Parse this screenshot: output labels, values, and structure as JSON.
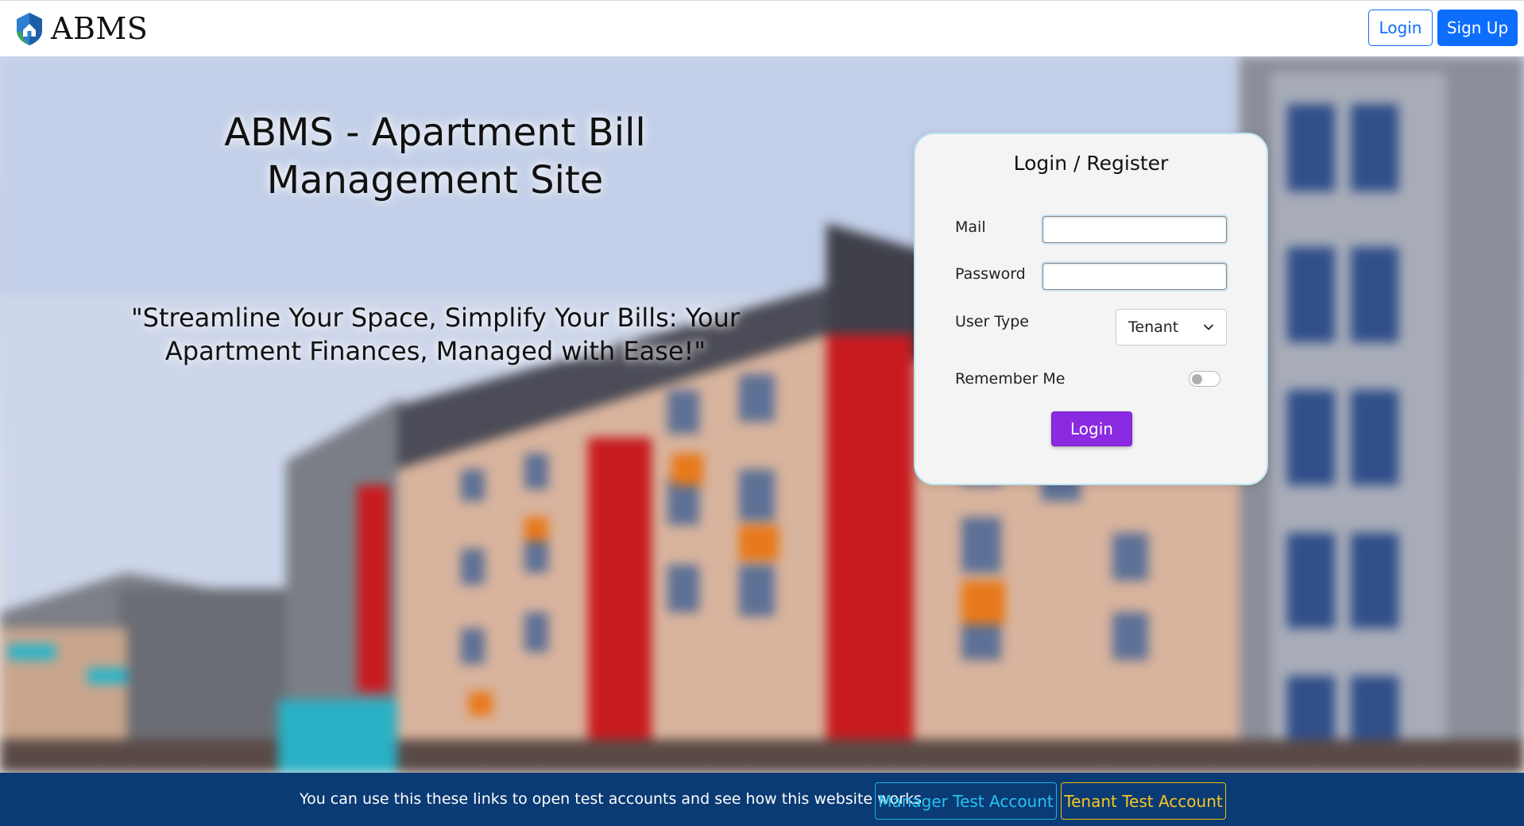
{
  "navbar": {
    "brand": "ABMS",
    "logo_icon": "house-shield-logo-icon",
    "login_label": "Login",
    "signup_label": "Sign Up",
    "accent": "#0d6efd"
  },
  "hero": {
    "title": "ABMS - Apartment Bill Management Site",
    "quote": "\"Streamline Your Space, Simplify Your Bills: Your Apartment Finances, Managed with Ease!\""
  },
  "login_card": {
    "title": "Login / Register",
    "mail_label": "Mail",
    "mail_value": "",
    "password_label": "Password",
    "password_value": "",
    "user_type_label": "User Type",
    "user_type_selected": "Tenant",
    "remember_label": "Remember Me",
    "remember_checked": false,
    "submit_label": "Login",
    "submit_color": "#8a2be2"
  },
  "footer": {
    "text": "You can use this these links to open test accounts and see how this website works",
    "manager_label": "Manager Test Account",
    "tenant_label": "Tenant Test Account",
    "background": "#0b3b74",
    "manager_color": "#26c2f2",
    "tenant_color": "#f6c722"
  }
}
